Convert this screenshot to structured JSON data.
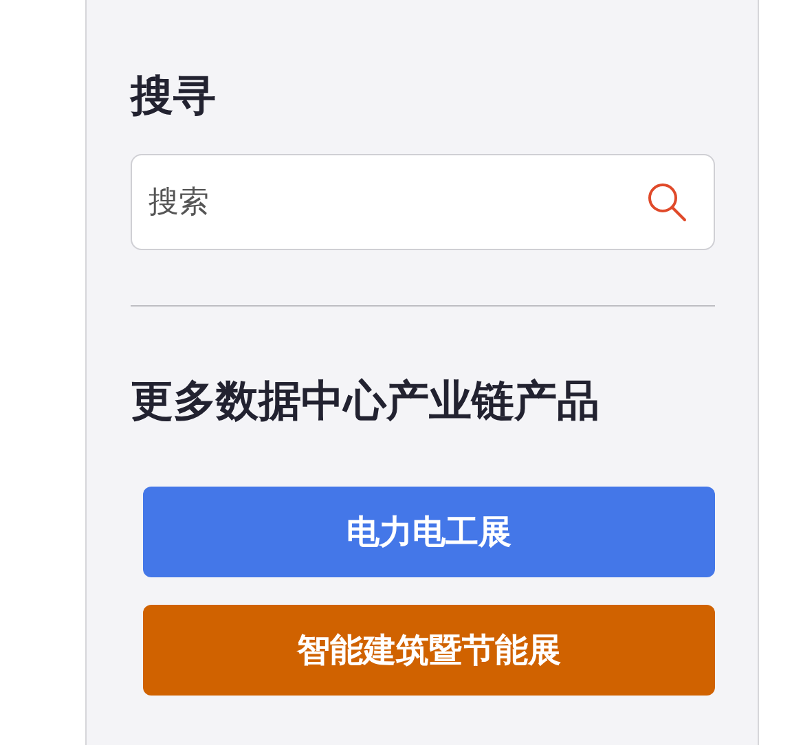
{
  "search_section": {
    "title": "搜寻",
    "search": {
      "placeholder": "搜索"
    }
  },
  "products_section": {
    "title": "更多数据中心产业链产品",
    "buttons": [
      {
        "label": "电力电工展",
        "color": "#4477e8"
      },
      {
        "label": "智能建筑暨节能展",
        "color": "#d06200"
      }
    ]
  }
}
